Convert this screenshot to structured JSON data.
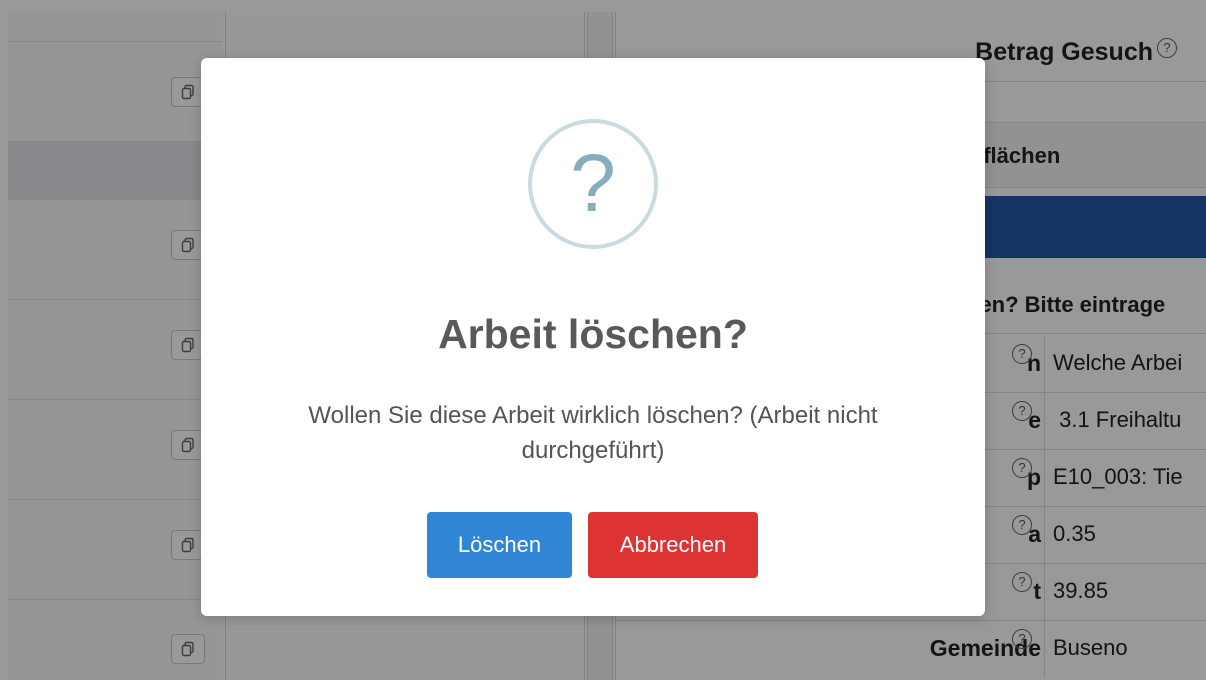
{
  "background": {
    "header_title": "Betrag Gesuch",
    "section_title": "sflächen",
    "question_text": "hen? Bitte eintrage",
    "rows": [
      {
        "label": "n",
        "value": "Welche Arbei"
      },
      {
        "label": "e",
        "value": " 3.1 Freihaltu"
      },
      {
        "label": "p",
        "value": "E10_003: Tie"
      },
      {
        "label": "a",
        "value": "0.35"
      },
      {
        "label": "t",
        "value": "39.85"
      },
      {
        "label": "Gemeinde",
        "value": "Buseno"
      }
    ],
    "help_glyph": "?"
  },
  "modal": {
    "icon_glyph": "?",
    "title": "Arbeit löschen?",
    "text": "Wollen Sie diese Arbeit wirklich löschen? (Arbeit nicht durchgeführt)",
    "confirm_label": "Löschen",
    "cancel_label": "Abbrechen"
  },
  "colors": {
    "confirm": "#3085d6",
    "cancel": "#dd3333",
    "accent_blue": "#2459a8"
  }
}
